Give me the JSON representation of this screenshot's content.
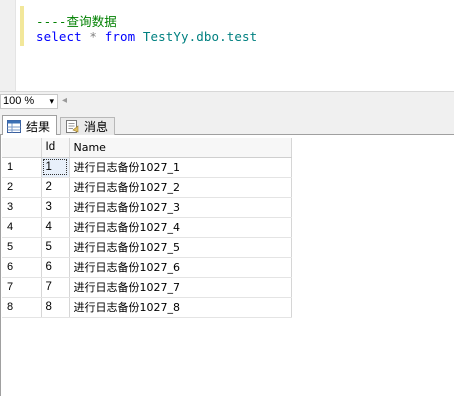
{
  "editor": {
    "comment_line": "----查询数据",
    "query": {
      "select": "select",
      "star": "*",
      "from": "from",
      "object": "TestYy.dbo.test"
    }
  },
  "zoom": {
    "value": "100 %",
    "arrow": "▾",
    "scroll_left": "◂"
  },
  "tabs": [
    {
      "label": "结果",
      "icon": "grid-icon",
      "active": true
    },
    {
      "label": "消息",
      "icon": "message-icon",
      "active": false
    }
  ],
  "results": {
    "columns": [
      "Id",
      "Name"
    ],
    "rows": [
      {
        "num": "1",
        "id": "1",
        "name": "进行日志备份1027_1"
      },
      {
        "num": "2",
        "id": "2",
        "name": "进行日志备份1027_2"
      },
      {
        "num": "3",
        "id": "3",
        "name": "进行日志备份1027_3"
      },
      {
        "num": "4",
        "id": "4",
        "name": "进行日志备份1027_4"
      },
      {
        "num": "5",
        "id": "5",
        "name": "进行日志备份1027_5"
      },
      {
        "num": "6",
        "id": "6",
        "name": "进行日志备份1027_6"
      },
      {
        "num": "7",
        "id": "7",
        "name": "进行日志备份1027_7"
      },
      {
        "num": "8",
        "id": "8",
        "name": "进行日志备份1027_8"
      }
    ]
  }
}
